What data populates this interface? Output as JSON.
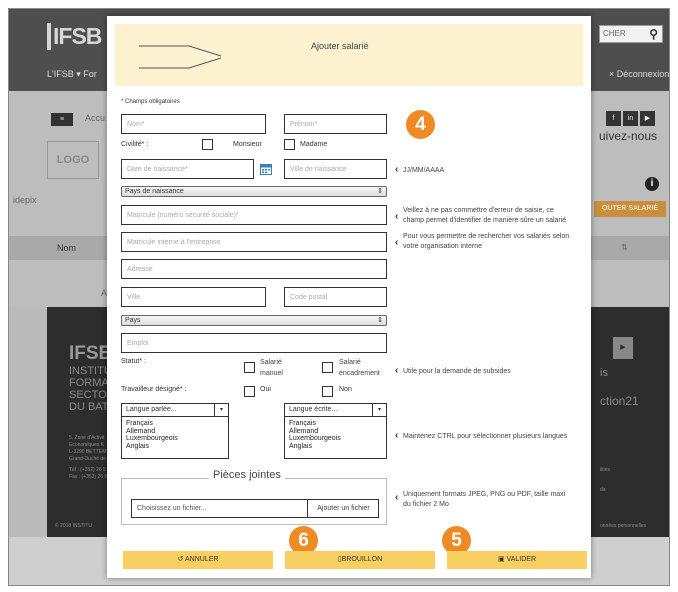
{
  "background": {
    "logo": "IFSB",
    "nav_label": "L'IFSB",
    "nav_item": "For",
    "search_text": "CHER",
    "logout": "× Déconnexion",
    "accueil": "Accu",
    "logo_placeholder": "LOGO",
    "company": "idepix",
    "follow_us": "uivez-nous",
    "add_employee": "OUTER SALARIÉ",
    "table_col": "Nom",
    "afficher": "Affic",
    "footer_logo": "IFSB",
    "footer_lines": [
      "INSTITUT",
      "FORMATI",
      "SECTORI",
      "DU BATIM"
    ],
    "footer_addr": [
      "5, Zone d'Activit",
      "Economiques K",
      "L-3290 BETTEM",
      "Grand-Duché de",
      "Tél : (+352) 26 5",
      "Fax : (+352) 26 5"
    ],
    "copyright": "© 2018 INSTITU",
    "footer_right_1": "is",
    "footer_right_2": "ction21",
    "footer_right_3": "ilités",
    "footer_right_4": "da",
    "footer_right_5": "onnées personnelles"
  },
  "modal": {
    "title": "Ajouter salarié",
    "required_note": "* Champs obligatoires",
    "fields": {
      "nom": "Nom*",
      "prenom": "Prénom*",
      "date_naissance": "Date de naissance*",
      "ville_naissance": "Ville de naissance",
      "pays_naissance": "Pays de naissance",
      "matricule": "Matricule (numéro sécurité sociale)*",
      "matricule_interne": "Matricule interne à l'entreprise",
      "adresse": "Adresse",
      "ville": "Ville",
      "code_postal": "Code postal",
      "pays": "Pays",
      "emploi": "Emploi"
    },
    "civilite_label": "Civilité* :",
    "monsieur": "Monsieur",
    "madame": "Madame",
    "statut_label": "Statut* :",
    "salarie_manuel": [
      "Salarié",
      "manuel"
    ],
    "salarie_encadrement": [
      "Salarié",
      "encadrement"
    ],
    "travailleur_label": "Travailleur désigné* :",
    "oui": "Oui",
    "non": "Non",
    "langue_parlee": "Langue parlée...",
    "langue_ecrite": "Langue écrite...",
    "langues": [
      "Français",
      "Allemand",
      "Luxembourgeois",
      "Anglais"
    ],
    "pieces_jointes": "Pièces jointes",
    "choose_file": "Choisissez un fichier...",
    "add_file": "Ajouter un fichier",
    "notes": {
      "date_format": "JJ/MM/AAAA",
      "matricule": [
        "Veillez à ne pas commettre d'erreur de saisie, ce",
        "champ permet d'identifier de manière sûre un salarié"
      ],
      "interne": [
        "Pour vous permettre de rechercher vos salariés selon",
        "votre organisation interne"
      ],
      "statut": "Utile pour la demande de subsides",
      "langues": "Maintenez CTRL pour sélectionner plusieurs langues",
      "fichier": [
        "Uniquement formats JPEG, PNG ou PDF, taille maxi",
        "du fichier 2 Mo"
      ]
    },
    "buttons": {
      "annuler": "ANNULER",
      "brouillon": "BROUILLON",
      "valider": "VALIDER"
    },
    "badges": [
      "4",
      "5",
      "6"
    ]
  },
  "colors": {
    "accent": "#f08a24",
    "button": "#f9cf62",
    "header_bg": "#fdf2cf"
  }
}
